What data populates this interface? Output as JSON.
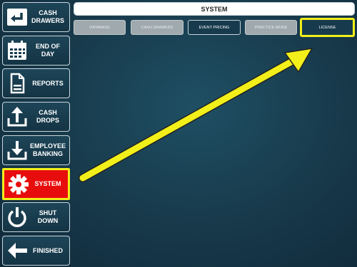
{
  "sidebar": {
    "items": [
      {
        "label": "CASH DRAWERS",
        "icon": "cash-drawer-return-icon"
      },
      {
        "label": "END OF DAY",
        "icon": "calendar-icon"
      },
      {
        "label": "REPORTS",
        "icon": "document-icon"
      },
      {
        "label": "CASH DROPS",
        "icon": "upload-tray-icon"
      },
      {
        "label": "EMPLOYEE BANKING",
        "icon": "download-tray-icon"
      },
      {
        "label": "SYSTEM",
        "icon": "gear-icon"
      },
      {
        "label": "SHUT DOWN",
        "icon": "power-icon"
      },
      {
        "label": "FINISHED",
        "icon": "arrow-left-icon"
      }
    ]
  },
  "header": {
    "title": "SYSTEM"
  },
  "tabs": [
    {
      "label": "DATABASE",
      "state": "disabled"
    },
    {
      "label": "CASH DRAWERS",
      "state": "disabled"
    },
    {
      "label": "EVENT PRICING",
      "state": "enabled"
    },
    {
      "label": "PRACTICE MODE",
      "state": "disabled"
    },
    {
      "label": "LICENSE",
      "state": "enabled"
    }
  ],
  "colors": {
    "active": "#e80d0d",
    "highlight": "#f2ef1a",
    "background": "#17394a"
  }
}
